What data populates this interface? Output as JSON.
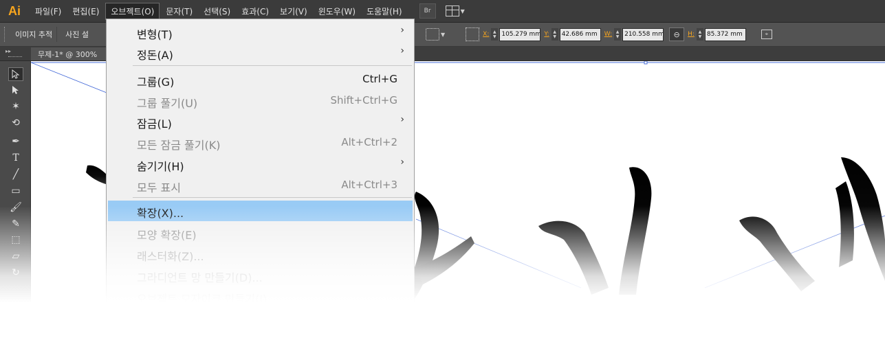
{
  "menubar": {
    "logo": "Ai",
    "items": [
      "파일(F)",
      "편집(E)",
      "오브젝트(O)",
      "문자(T)",
      "선택(S)",
      "효과(C)",
      "보기(V)",
      "윈도우(W)",
      "도움말(H)"
    ],
    "active_index": 2,
    "bridge_label": "Br"
  },
  "controlbar": {
    "image_trace": "이미지 추적",
    "preset": "사진 설",
    "fields": [
      {
        "label": "X:",
        "value": "105.279 mm"
      },
      {
        "label": "Y:",
        "value": "42.686 mm"
      },
      {
        "label": "W:",
        "value": "210.558 mm"
      },
      {
        "label": "H:",
        "value": "85.372 mm"
      }
    ]
  },
  "document": {
    "tab_title": "무제-1* @ 300%"
  },
  "dropdown": {
    "items": [
      {
        "label": "변형(T)",
        "shortcut": "",
        "submenu": true,
        "disabled": false
      },
      {
        "label": "정돈(A)",
        "shortcut": "",
        "submenu": true,
        "disabled": false
      },
      {
        "label": "그룹(G)",
        "shortcut": "Ctrl+G",
        "submenu": false,
        "disabled": false
      },
      {
        "label": "그룹 풀기(U)",
        "shortcut": "Shift+Ctrl+G",
        "submenu": false,
        "disabled": true
      },
      {
        "label": "잠금(L)",
        "shortcut": "",
        "submenu": true,
        "disabled": false
      },
      {
        "label": "모든 잠금 풀기(K)",
        "shortcut": "Alt+Ctrl+2",
        "submenu": false,
        "disabled": true
      },
      {
        "label": "숨기기(H)",
        "shortcut": "",
        "submenu": true,
        "disabled": false
      },
      {
        "label": "모두 표시",
        "shortcut": "Alt+Ctrl+3",
        "submenu": false,
        "disabled": true
      },
      {
        "label": "확장(X)...",
        "shortcut": "",
        "submenu": false,
        "disabled": false,
        "highlight": true
      },
      {
        "label": "모양 확장(E)",
        "shortcut": "",
        "submenu": false,
        "disabled": true
      },
      {
        "label": "래스터화(Z)...",
        "shortcut": "",
        "submenu": false,
        "disabled": true
      },
      {
        "label": "그라디언트 망 만들기(D)...",
        "shortcut": "",
        "submenu": false,
        "disabled": true
      },
      {
        "label": "오브젝트 모자이크 만들기(J)...",
        "shortcut": "",
        "submenu": false,
        "disabled": true
      }
    ]
  },
  "icons": {
    "submenu_arrow": "chevron-right-icon",
    "selection_tool": "arrow-icon",
    "link": "chain-link-icon"
  },
  "colors": {
    "accent": "#f7a51d",
    "menu_highlight": "#99cbf5",
    "menubar_bg": "#3b3b3b",
    "controlbar_bg": "#535353"
  }
}
